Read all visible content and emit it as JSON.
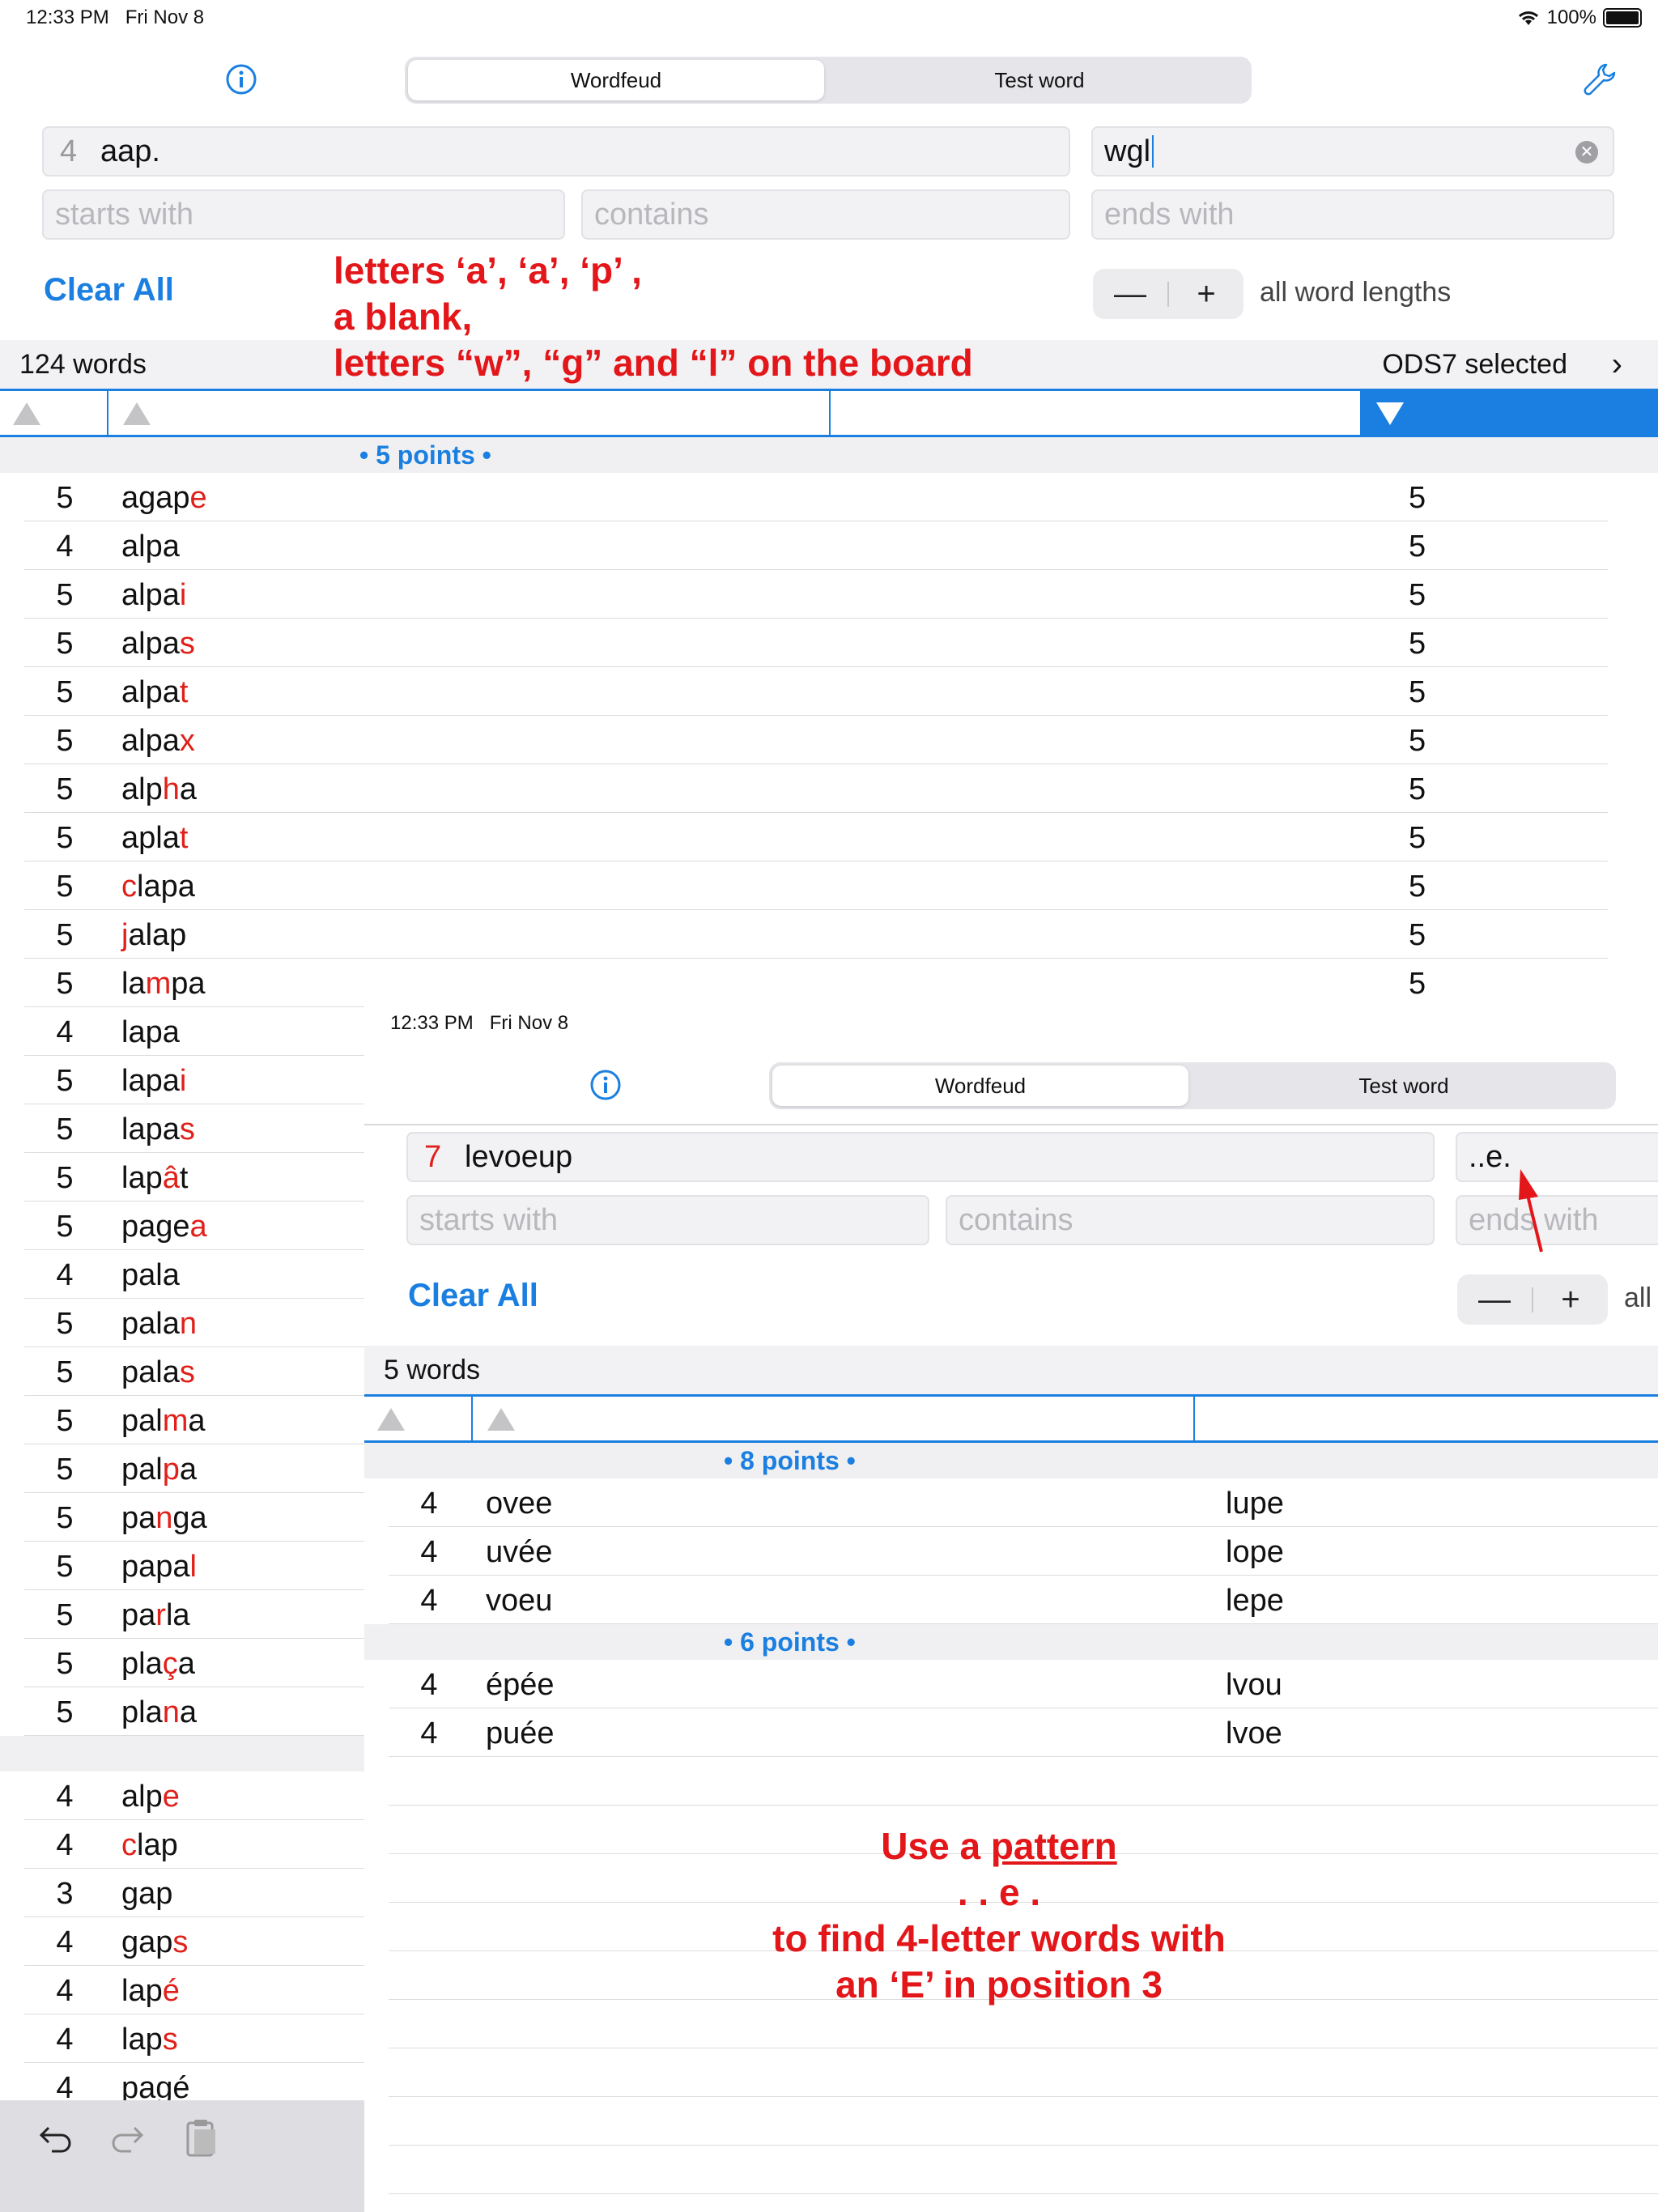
{
  "status": {
    "time": "12:33 PM",
    "date": "Fri Nov 8",
    "battery": "100%"
  },
  "tabs": [
    {
      "label": "Wordfeud",
      "selected": true
    },
    {
      "label": "Test word",
      "selected": false
    }
  ],
  "search": {
    "rack_count": "4",
    "rack_value": "aap.",
    "board_value": "wgl",
    "starts_ph": "starts with",
    "contains_ph": "contains",
    "ends_ph": "ends with",
    "clear_label": "Clear All",
    "minus": "—",
    "plus": "+",
    "length_label": "all word lengths"
  },
  "results": {
    "count": "124 words",
    "dict": "ODS7 selected"
  },
  "sections": [
    {
      "label": "• 5 points •"
    }
  ],
  "words": [
    {
      "n": "5",
      "pre": "agap",
      "hl": "e",
      "post": "",
      "score": "5"
    },
    {
      "n": "4",
      "pre": "alpa",
      "hl": "",
      "post": "",
      "score": "5"
    },
    {
      "n": "5",
      "pre": "alpa",
      "hl": "i",
      "post": "",
      "score": "5"
    },
    {
      "n": "5",
      "pre": "alpa",
      "hl": "s",
      "post": "",
      "score": "5"
    },
    {
      "n": "5",
      "pre": "alpa",
      "hl": "t",
      "post": "",
      "score": "5"
    },
    {
      "n": "5",
      "pre": "alpa",
      "hl": "x",
      "post": "",
      "score": "5"
    },
    {
      "n": "5",
      "pre": "alp",
      "hl": "h",
      "post": "a",
      "score": "5"
    },
    {
      "n": "5",
      "pre": "apla",
      "hl": "t",
      "post": "",
      "score": "5"
    },
    {
      "n": "5",
      "pre": "",
      "hl": "c",
      "post": "lapa",
      "score": "5"
    },
    {
      "n": "5",
      "pre": "",
      "hl": "j",
      "post": "alap",
      "score": "5"
    },
    {
      "n": "5",
      "pre": "la",
      "hl": "m",
      "post": "pa",
      "score": "5"
    },
    {
      "n": "4",
      "pre": "lapa",
      "hl": "",
      "post": "",
      "score": ""
    },
    {
      "n": "5",
      "pre": "lapa",
      "hl": "i",
      "post": "",
      "score": ""
    },
    {
      "n": "5",
      "pre": "lapa",
      "hl": "s",
      "post": "",
      "score": ""
    },
    {
      "n": "5",
      "pre": "lap",
      "hl": "â",
      "post": "t",
      "score": ""
    },
    {
      "n": "5",
      "pre": "page",
      "hl": "a",
      "post": "",
      "score": ""
    },
    {
      "n": "4",
      "pre": "pala",
      "hl": "",
      "post": "",
      "score": ""
    },
    {
      "n": "5",
      "pre": "pala",
      "hl": "n",
      "post": "",
      "score": ""
    },
    {
      "n": "5",
      "pre": "pala",
      "hl": "s",
      "post": "",
      "score": ""
    },
    {
      "n": "5",
      "pre": "pal",
      "hl": "m",
      "post": "a",
      "score": ""
    },
    {
      "n": "5",
      "pre": "pal",
      "hl": "p",
      "post": "a",
      "score": ""
    },
    {
      "n": "5",
      "pre": "pa",
      "hl": "n",
      "post": "ga",
      "score": ""
    },
    {
      "n": "5",
      "pre": "papa",
      "hl": "l",
      "post": "",
      "score": ""
    },
    {
      "n": "5",
      "pre": "pa",
      "hl": "r",
      "post": "la",
      "score": ""
    },
    {
      "n": "5",
      "pre": "pla",
      "hl": "ç",
      "post": "a",
      "score": ""
    },
    {
      "n": "5",
      "pre": "pla",
      "hl": "n",
      "post": "a",
      "score": ""
    }
  ],
  "words2": [
    {
      "n": "4",
      "pre": "alp",
      "hl": "e",
      "post": ""
    },
    {
      "n": "4",
      "pre": "",
      "hl": "c",
      "post": "lap"
    },
    {
      "n": "3",
      "pre": "gap",
      "hl": "",
      "post": ""
    },
    {
      "n": "4",
      "pre": "gap",
      "hl": "s",
      "post": ""
    },
    {
      "n": "4",
      "pre": "lap",
      "hl": "é",
      "post": ""
    },
    {
      "n": "4",
      "pre": "lap",
      "hl": "s",
      "post": ""
    },
    {
      "n": "4",
      "pre": "pagé",
      "hl": "",
      "post": ""
    }
  ],
  "annotation1": {
    "l1": "letters ‘a’, ‘a’, ‘p’ ,",
    "l2": "a blank,",
    "l3": "letters “w”, “g” and “l” on the board"
  },
  "inset": {
    "time": "12:33 PM",
    "date": "Fri Nov 8",
    "tabs": [
      {
        "label": "Wordfeud"
      },
      {
        "label": "Test word"
      }
    ],
    "rack_count": "7",
    "rack_value": "levoeup",
    "pattern_value": "..e.",
    "starts_ph": "starts with",
    "contains_ph": "contains",
    "ends_ph": "ends with",
    "clear_label": "Clear All",
    "minus": "—",
    "plus": "+",
    "length_label": "all",
    "count": "5 words",
    "sections": [
      {
        "label": "• 8 points •"
      },
      {
        "label": "• 6 points •"
      }
    ],
    "rows": [
      {
        "n": "4",
        "word": "ovee",
        "used": "lupe"
      },
      {
        "n": "4",
        "word": "uvée",
        "used": "lope"
      },
      {
        "n": "4",
        "word": "voeu",
        "used": "lepe"
      },
      {
        "n": "4",
        "word": "épée",
        "used": "lvou"
      },
      {
        "n": "4",
        "word": "puée",
        "used": "lvoe"
      }
    ],
    "annotation": {
      "l1a": "Use a ",
      "l1b": "pattern",
      "l2": ". . e .",
      "l3": "to find 4-letter words with",
      "l4": "an ‘E’ in position 3"
    }
  },
  "toolbar": {
    "undo": "undo-icon",
    "redo": "redo-icon",
    "paste": "clipboard-icon"
  },
  "colors": {
    "accent": "#1a7fe0",
    "highlight": "#e0201a",
    "annotation": "#e3161a"
  }
}
